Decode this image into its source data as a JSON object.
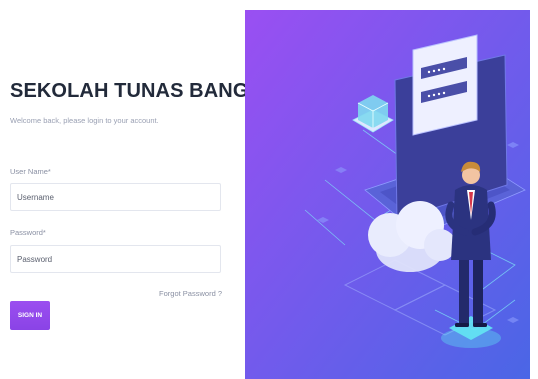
{
  "login": {
    "title": "SEKOLAH TUNAS BANGSA",
    "subtitle": "Welcome back, please login to your account.",
    "username": {
      "label": "User Name*",
      "placeholder": "Username",
      "value": ""
    },
    "password": {
      "label": "Password*",
      "placeholder": "Password",
      "value": ""
    },
    "forgot_label": "Forgot Password ?",
    "signin_label": "SIGN IN"
  },
  "colors": {
    "accent": "#8f47ea",
    "title": "#222a3a",
    "hero_gradient_start": "#9a4ff2",
    "hero_gradient_end": "#4a66e6"
  },
  "hero": {
    "illustration": "cloud-computing-laptop-illustration",
    "icons": [
      "password-window-icon",
      "cube-server-icon",
      "cloud-icon",
      "businessman-figure"
    ]
  }
}
